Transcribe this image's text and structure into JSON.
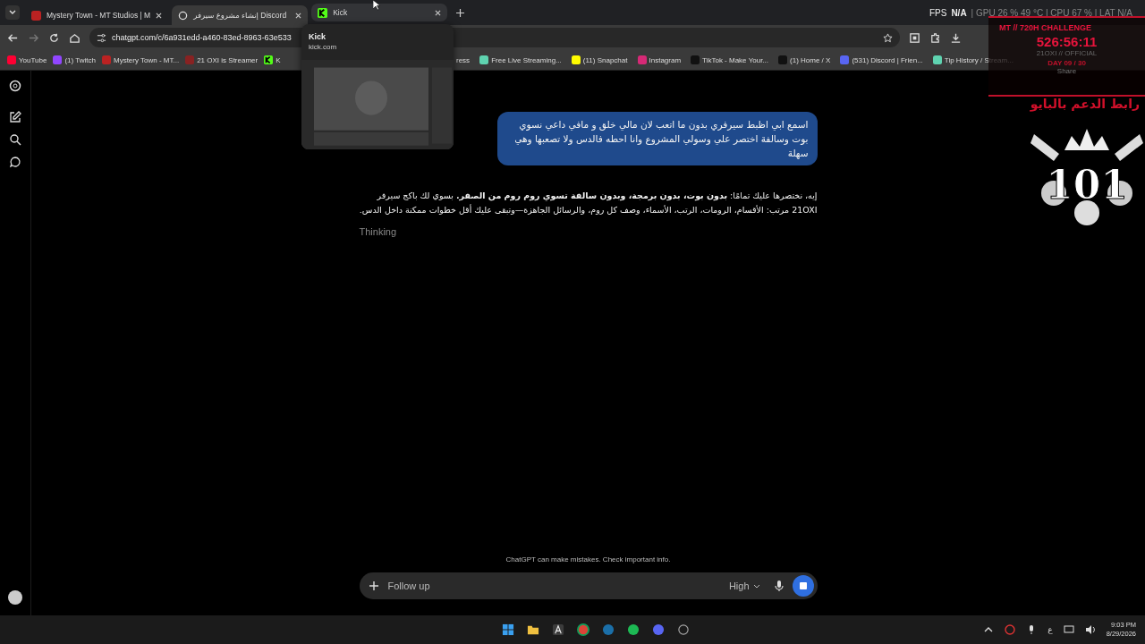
{
  "tabs": [
    {
      "title": "Mystery Town - MT Studios | M",
      "kind": "mt",
      "selected": false,
      "hovered": false
    },
    {
      "title": "إنشاء مشروع سيرفر Discord",
      "kind": "openai",
      "selected": true,
      "hovered": false
    },
    {
      "title": "Kick",
      "kind": "kick",
      "selected": false,
      "hovered": true
    }
  ],
  "tab_preview": {
    "title": "Kick",
    "url": "kick.com"
  },
  "address_bar": {
    "url": "chatgpt.com/c/6a931edd-a460-83ed-8963-63e533"
  },
  "perf_overlay": {
    "label": "FPS",
    "fps": "N/A",
    "stats": "| GPU 26 % 49 °C | CPU 67 % | LAT N/A"
  },
  "bookmarks": [
    {
      "label": "YouTube",
      "kind": "youtube"
    },
    {
      "label": "(1) Twitch",
      "kind": "twitch"
    },
    {
      "label": "Mystery Town - MT...",
      "kind": "mt"
    },
    {
      "label": "21 OXI is Streamer",
      "kind": "oxi"
    },
    {
      "label": "K",
      "kind": "kick"
    },
    {
      "label": "ress",
      "kind": "none"
    },
    {
      "label": "Free Live Streaming...",
      "kind": "stream"
    },
    {
      "label": "(11) Snapchat",
      "kind": "snapchat"
    },
    {
      "label": "Instagram",
      "kind": "instagram"
    },
    {
      "label": "TikTok - Make Your...",
      "kind": "tiktok"
    },
    {
      "label": "(1) Home / X",
      "kind": "x"
    },
    {
      "label": "(531) Discord | Frien...",
      "kind": "discord"
    },
    {
      "label": "Tip History / Stream...",
      "kind": "stream"
    }
  ],
  "stream_overlay": {
    "title": "MT // 720H CHALLENGE",
    "timer": "526:56:11",
    "channel": "21OXI // OFFICIAL",
    "day": "DAY 09 / 30",
    "share": "Share",
    "support": "رابط الدعم بالبايو",
    "logo_text": "101"
  },
  "messages": [
    {
      "kind": "user",
      "text": "اسمع ابي اظبط سيرفري بدون ما اتعب لان مالي خلق و مافي داعي نسوي بوت وسالفة اختصر علي وسولي المشروع وانا احطه فالدس ولا تصعبها وهي سهلة"
    },
    {
      "kind": "assistant",
      "text": "إيه، نختصرها عليك تمامًا: **بدون بوت، بدون برمجة، وبدون سالفة تسوي روم روم من الصفر.** بسوي لك باكج سيرفر 21OXI مرتب: الأقسام، الرومات، الرتب، الأسماء، وصف كل روم، والرسائل الجاهزة—وتبقى عليك أقل خطوات ممكنة داخل الدس."
    },
    {
      "kind": "status",
      "text": "Thinking"
    }
  ],
  "disclaimer": "ChatGPT can make mistakes. Check important info.",
  "composer": {
    "placeholder": "Follow up",
    "model": "High"
  },
  "taskbar": {
    "apps": [
      {
        "kind": "windows"
      },
      {
        "kind": "folder"
      },
      {
        "kind": "font"
      },
      {
        "kind": "chrome"
      },
      {
        "kind": "steam"
      },
      {
        "kind": "spotify"
      },
      {
        "kind": "discord"
      },
      {
        "kind": "clock"
      }
    ],
    "language": "ع",
    "time": "9:03 PM",
    "date": "8/29/2026"
  }
}
